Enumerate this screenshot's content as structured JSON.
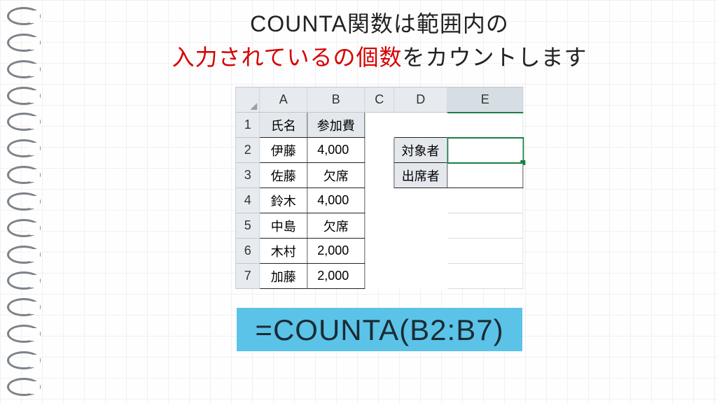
{
  "title": {
    "line1": "COUNTA関数は範囲内の",
    "highlight": "入力されているの個数",
    "line2_rest": "をカウントします"
  },
  "sheet": {
    "columns": [
      "A",
      "B",
      "C",
      "D",
      "E"
    ],
    "rows": [
      "1",
      "2",
      "3",
      "4",
      "5",
      "6",
      "7"
    ],
    "data": {
      "A1": "氏名",
      "B1": "参加費",
      "A2": "伊藤",
      "B2": "4,000",
      "D2": "対象者",
      "A3": "佐藤",
      "B3": "欠席",
      "D3": "出席者",
      "A4": "鈴木",
      "B4": "4,000",
      "A5": "中島",
      "B5": "欠席",
      "A6": "木村",
      "B6": "2,000",
      "A7": "加藤",
      "B7": "2,000"
    }
  },
  "formula": "=COUNTA(B2:B7)"
}
